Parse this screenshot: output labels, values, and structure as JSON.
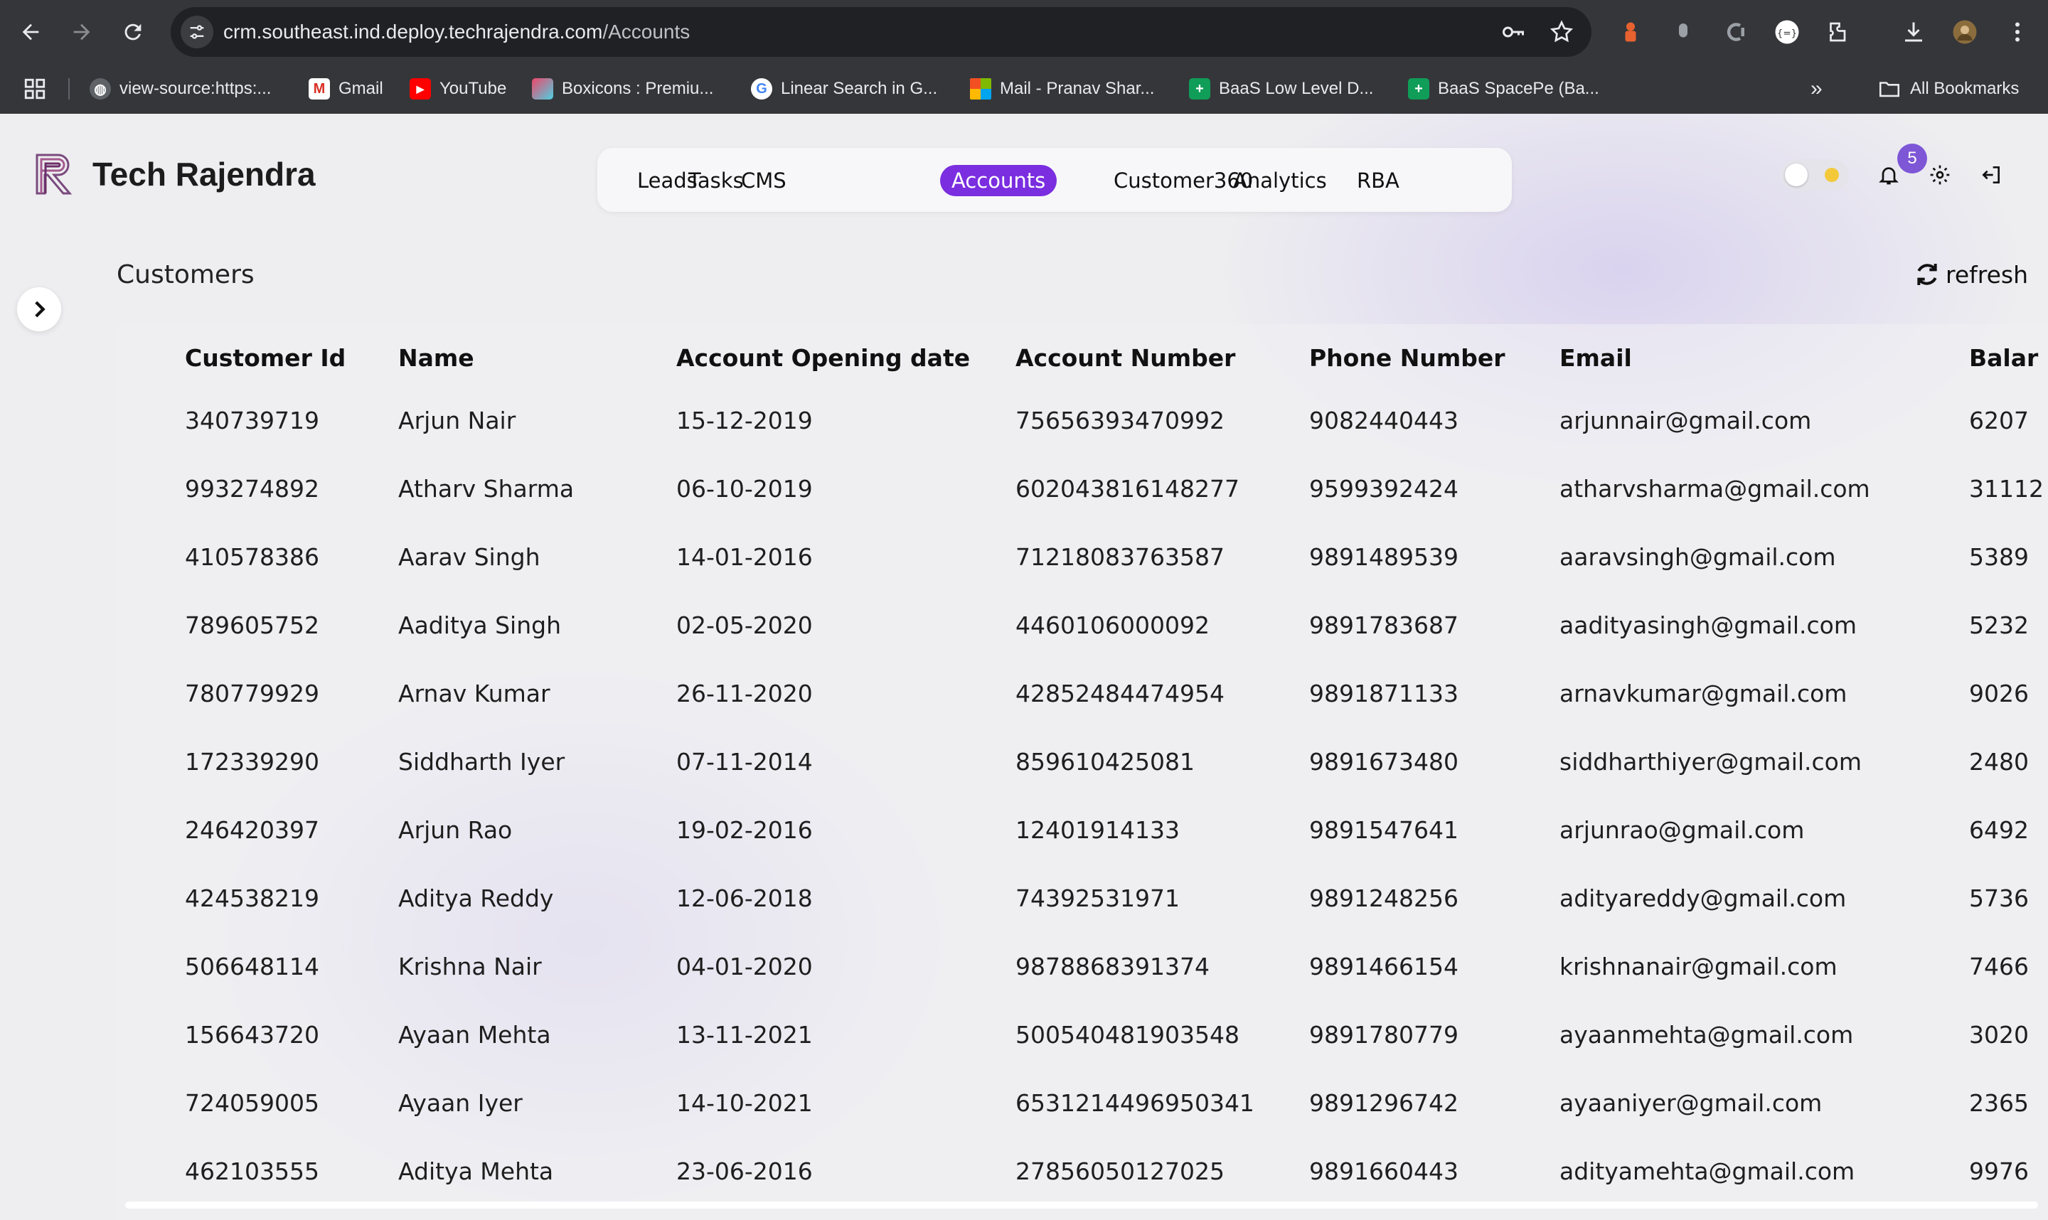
{
  "browser": {
    "url_host": "crm.southeast.ind.deploy.techrajendra.com",
    "url_path": "/Accounts",
    "bookmarks": [
      {
        "icon": "globe-icon",
        "label": "view-source:https:..."
      },
      {
        "icon": "gmail-icon",
        "label": "Gmail"
      },
      {
        "icon": "youtube-icon",
        "label": "YouTube"
      },
      {
        "icon": "boxicons-icon",
        "label": "Boxicons : Premiu..."
      },
      {
        "icon": "google-icon",
        "label": "Linear Search in G..."
      },
      {
        "icon": "microsoft-icon",
        "label": "Mail - Pranav Shar..."
      },
      {
        "icon": "sheets-icon",
        "label": "BaaS Low Level D..."
      },
      {
        "icon": "sheets-icon",
        "label": "BaaS SpacePe (Ba..."
      }
    ],
    "all_bookmarks_label": "All Bookmarks",
    "overflow_label": "»"
  },
  "app": {
    "brand": "Tech Rajendra",
    "nav_tabs": [
      "Leads",
      "Tasks",
      "CMS",
      "Accounts",
      "Customer360",
      "Analytics",
      "RBA"
    ],
    "active_tab": "Accounts",
    "notification_count": "5",
    "accent_color": "#7a2ee0"
  },
  "page": {
    "title": "Customers",
    "refresh_label": "refresh"
  },
  "table": {
    "columns": [
      "Customer Id",
      "Name",
      "Account Opening date",
      "Account Number",
      "Phone Number",
      "Email",
      "Balar"
    ],
    "rows": [
      [
        "340739719",
        "Arjun Nair",
        "15-12-2019",
        "75656393470992",
        "9082440443",
        "arjunnair@gmail.com",
        "6207"
      ],
      [
        "993274892",
        "Atharv Sharma",
        "06-10-2019",
        "602043816148277",
        "9599392424",
        "atharvsharma@gmail.com",
        "31112"
      ],
      [
        "410578386",
        "Aarav Singh",
        "14-01-2016",
        "71218083763587",
        "9891489539",
        "aaravsingh@gmail.com",
        "5389"
      ],
      [
        "789605752",
        "Aaditya Singh",
        "02-05-2020",
        "4460106000092",
        "9891783687",
        "aadityasingh@gmail.com",
        "5232"
      ],
      [
        "780779929",
        "Arnav Kumar",
        "26-11-2020",
        "42852484474954",
        "9891871133",
        "arnavkumar@gmail.com",
        "9026"
      ],
      [
        "172339290",
        "Siddharth Iyer",
        "07-11-2014",
        "859610425081",
        "9891673480",
        "siddharthiyer@gmail.com",
        "2480"
      ],
      [
        "246420397",
        "Arjun Rao",
        "19-02-2016",
        "12401914133",
        "9891547641",
        "arjunrao@gmail.com",
        "6492"
      ],
      [
        "424538219",
        "Aditya Reddy",
        "12-06-2018",
        "74392531971",
        "9891248256",
        "adityareddy@gmail.com",
        "5736"
      ],
      [
        "506648114",
        "Krishna Nair",
        "04-01-2020",
        "9878868391374",
        "9891466154",
        "krishnanair@gmail.com",
        "7466"
      ],
      [
        "156643720",
        "Ayaan Mehta",
        "13-11-2021",
        "500540481903548",
        "9891780779",
        "ayaanmehta@gmail.com",
        "3020"
      ],
      [
        "724059005",
        "Ayaan Iyer",
        "14-10-2021",
        "6531214496950341",
        "9891296742",
        "ayaaniyer@gmail.com",
        "2365"
      ],
      [
        "462103555",
        "Aditya Mehta",
        "23-06-2016",
        "27856050127025",
        "9891660443",
        "adityamehta@gmail.com",
        "9976"
      ]
    ]
  }
}
